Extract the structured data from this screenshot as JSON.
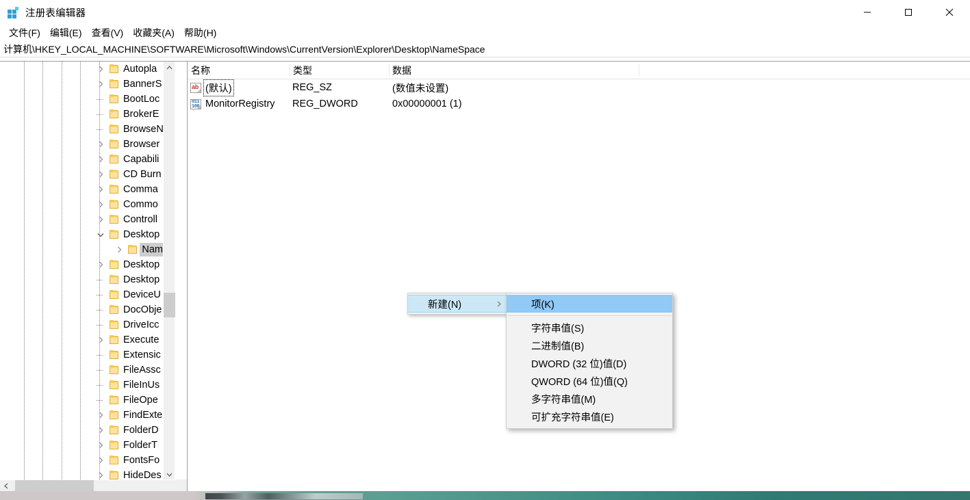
{
  "window": {
    "title": "注册表编辑器",
    "app_icon": "registry-editor-icon",
    "controls": {
      "minimize": "minimize-icon",
      "maximize": "maximize-icon",
      "close": "close-icon"
    }
  },
  "menu_bar": {
    "items": [
      {
        "label": "文件(F)"
      },
      {
        "label": "编辑(E)"
      },
      {
        "label": "查看(V)"
      },
      {
        "label": "收藏夹(A)"
      },
      {
        "label": "帮助(H)"
      }
    ]
  },
  "address_bar": {
    "path": "计算机\\HKEY_LOCAL_MACHINE\\SOFTWARE\\Microsoft\\Windows\\CurrentVersion\\Explorer\\Desktop\\NameSpace"
  },
  "tree": {
    "items": [
      {
        "label": "Autopla",
        "indent": 5,
        "expander": "collapsed",
        "selected": false
      },
      {
        "label": "BannerS",
        "indent": 5,
        "expander": "collapsed",
        "selected": false
      },
      {
        "label": "BootLoc",
        "indent": 5,
        "expander": "leaf",
        "selected": false
      },
      {
        "label": "BrokerE",
        "indent": 5,
        "expander": "leaf",
        "selected": false
      },
      {
        "label": "BrowseN",
        "indent": 5,
        "expander": "leaf",
        "selected": false
      },
      {
        "label": "Browser",
        "indent": 5,
        "expander": "collapsed",
        "selected": false
      },
      {
        "label": "Capabili",
        "indent": 5,
        "expander": "collapsed",
        "selected": false
      },
      {
        "label": "CD Burn",
        "indent": 5,
        "expander": "collapsed",
        "selected": false
      },
      {
        "label": "Comma",
        "indent": 5,
        "expander": "collapsed",
        "selected": false
      },
      {
        "label": "Commo",
        "indent": 5,
        "expander": "collapsed",
        "selected": false
      },
      {
        "label": "Controll",
        "indent": 5,
        "expander": "collapsed",
        "selected": false
      },
      {
        "label": "Desktop",
        "indent": 5,
        "expander": "expanded",
        "selected": false
      },
      {
        "label": "Name",
        "indent": 6,
        "expander": "collapsed",
        "selected": true
      },
      {
        "label": "Desktop",
        "indent": 5,
        "expander": "collapsed",
        "selected": false
      },
      {
        "label": "Desktop",
        "indent": 5,
        "expander": "leaf",
        "selected": false
      },
      {
        "label": "DeviceU",
        "indent": 5,
        "expander": "leaf",
        "selected": false
      },
      {
        "label": "DocObje",
        "indent": 5,
        "expander": "leaf",
        "selected": false
      },
      {
        "label": "DriveIcc",
        "indent": 5,
        "expander": "leaf",
        "selected": false
      },
      {
        "label": "Execute",
        "indent": 5,
        "expander": "collapsed",
        "selected": false
      },
      {
        "label": "Extensic",
        "indent": 5,
        "expander": "leaf",
        "selected": false
      },
      {
        "label": "FileAssc",
        "indent": 5,
        "expander": "leaf",
        "selected": false
      },
      {
        "label": "FileInUs",
        "indent": 5,
        "expander": "leaf",
        "selected": false
      },
      {
        "label": "FileOpe",
        "indent": 5,
        "expander": "leaf",
        "selected": false
      },
      {
        "label": "FindExte",
        "indent": 5,
        "expander": "collapsed",
        "selected": false
      },
      {
        "label": "FolderD",
        "indent": 5,
        "expander": "collapsed",
        "selected": false
      },
      {
        "label": "FolderT",
        "indent": 5,
        "expander": "collapsed",
        "selected": false
      },
      {
        "label": "FontsFo",
        "indent": 5,
        "expander": "collapsed",
        "selected": false
      },
      {
        "label": "HideDes",
        "indent": 5,
        "expander": "collapsed",
        "selected": false
      }
    ]
  },
  "list": {
    "columns": [
      {
        "label": "名称"
      },
      {
        "label": "类型"
      },
      {
        "label": "数据"
      }
    ],
    "rows": [
      {
        "icon": "string-value-icon",
        "name": "(默认)",
        "type": "REG_SZ",
        "data": "(数值未设置)",
        "focused": true
      },
      {
        "icon": "dword-value-icon",
        "name": "MonitorRegistry",
        "type": "REG_DWORD",
        "data": "0x00000001 (1)",
        "focused": false
      }
    ]
  },
  "context_menu": {
    "items": [
      {
        "label": "新建(N)",
        "has_submenu": true,
        "highlighted": true
      }
    ],
    "submenu": {
      "items": [
        {
          "label": "项(K)",
          "highlighted": true,
          "separator_after": true
        },
        {
          "label": "字符串值(S)",
          "highlighted": false,
          "separator_after": false
        },
        {
          "label": "二进制值(B)",
          "highlighted": false,
          "separator_after": false
        },
        {
          "label": "DWORD (32 位)值(D)",
          "highlighted": false,
          "separator_after": false
        },
        {
          "label": "QWORD (64 位)值(Q)",
          "highlighted": false,
          "separator_after": false
        },
        {
          "label": "多字符串值(M)",
          "highlighted": false,
          "separator_after": false
        },
        {
          "label": "可扩充字符串值(E)",
          "highlighted": false,
          "separator_after": false
        }
      ]
    }
  },
  "colors": {
    "menu_highlight": "#cce8f7",
    "submenu_highlight": "#91c9f7",
    "tree_selection": "#cdcdcd",
    "folder": "#ffd773",
    "accent": "#2f9fd0"
  }
}
